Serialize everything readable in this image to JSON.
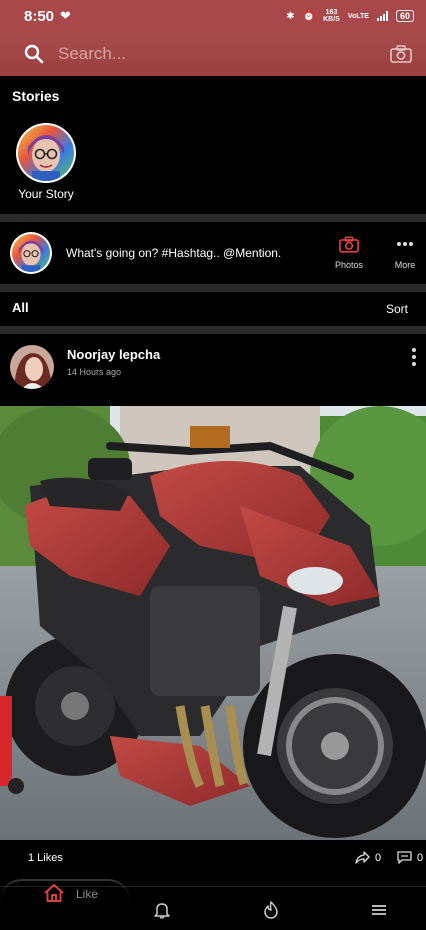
{
  "status_bar": {
    "time": "8:50",
    "speed_value": "163",
    "speed_unit": "KB/S",
    "net_label": "VoLTE",
    "battery": "60"
  },
  "search": {
    "placeholder": "Search..."
  },
  "stories": {
    "title": "Stories",
    "items": [
      {
        "label": "Your Story"
      }
    ]
  },
  "composer": {
    "prompt": "What's going on? #Hashtag.. @Mention.",
    "photos_label": "Photos",
    "more_label": "More"
  },
  "filter": {
    "all_label": "All",
    "sort_label": "Sort"
  },
  "post": {
    "author": "Noorjay lepcha",
    "time_ago": "14 Hours ago",
    "likes": "1 Likes",
    "shares": "0",
    "comments": "0"
  },
  "bottom_nav": {
    "ghost_label": "Like",
    "items": [
      "home-icon",
      "bell-icon",
      "fire-icon",
      "menu-icon"
    ]
  },
  "colors": {
    "accent": "#a8484a",
    "home_active": "#e0403f"
  }
}
